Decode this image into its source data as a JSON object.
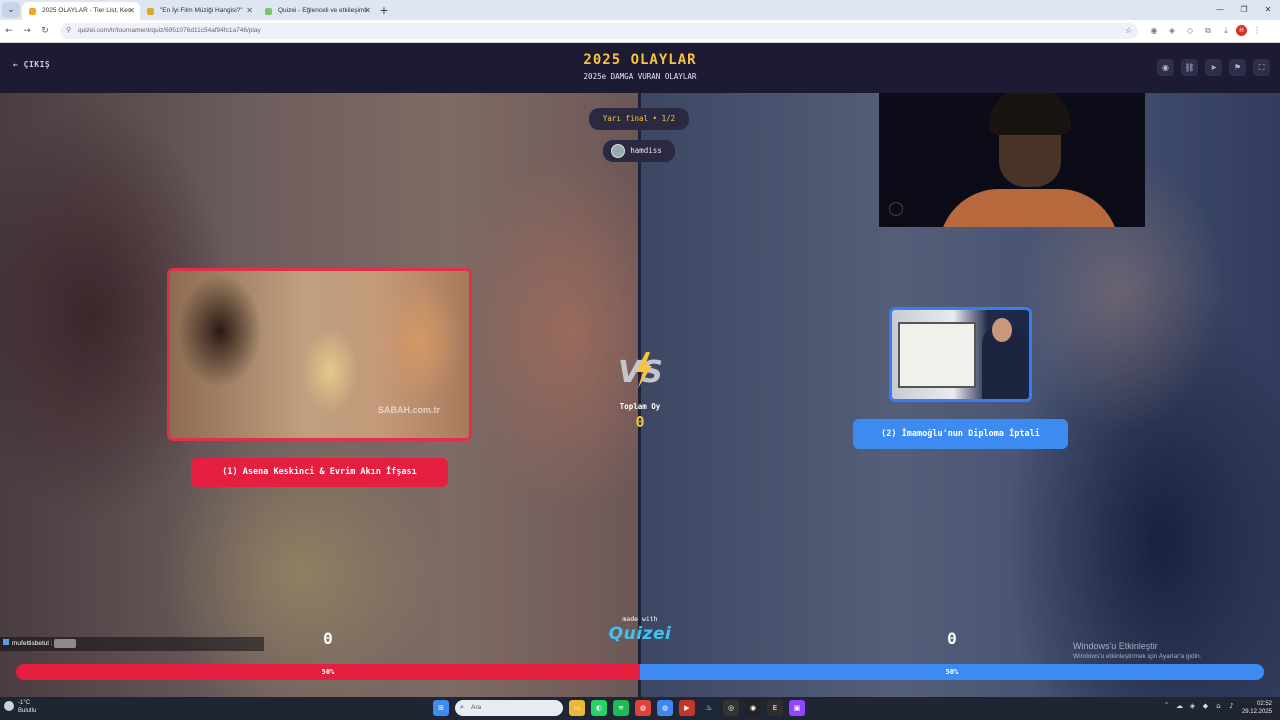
{
  "browser": {
    "tabs": [
      {
        "title": "2025 OLAYLAR - Tier List, Kes"
      },
      {
        "title": "\"En İyi Film Müziği Hangisi?\""
      },
      {
        "title": "Quizei - Eğlenceli ve etkileşimli"
      }
    ],
    "url": "quizei.com/tr/tournament/quiz/6951076d11c54af94fc1a746/play"
  },
  "quiz": {
    "exit_label": "ÇIKIŞ",
    "title": "2025 OLAYLAR",
    "subtitle": "2025e DAMGA VURAN OLAYLAR",
    "round": "Yarı final • 1/2",
    "user": "hamdiss",
    "left": {
      "label": "(1) Asena Keskinci & Evrim Akın İfşası",
      "votes": "0",
      "percent_label": "50%",
      "percent": 50
    },
    "right": {
      "label": "(2) İmamoğlu'nun Diploma İptali",
      "votes": "0",
      "percent_label": "50%",
      "percent": 50
    },
    "total_label": "Toplam Oy",
    "total_value": "0",
    "made_with": "made with",
    "brand": "Quizei",
    "watermark": "SABAH.com.tr"
  },
  "chat": {
    "username": "mufettisbetul :"
  },
  "windows_activation": {
    "title": "Windows'u Etkinleştir",
    "subtitle": "Windows'u etkinleştirmek için Ayarlar'a gidin."
  },
  "taskbar": {
    "weather_temp": "-1°C",
    "weather_desc": "Bulutlu",
    "search_placeholder": "Ara",
    "time": "02:52",
    "date": "29.12.2025"
  },
  "colors": {
    "left_accent": "#e51f40",
    "right_accent": "#3d8bf2",
    "title_yellow": "#f6c43c"
  }
}
